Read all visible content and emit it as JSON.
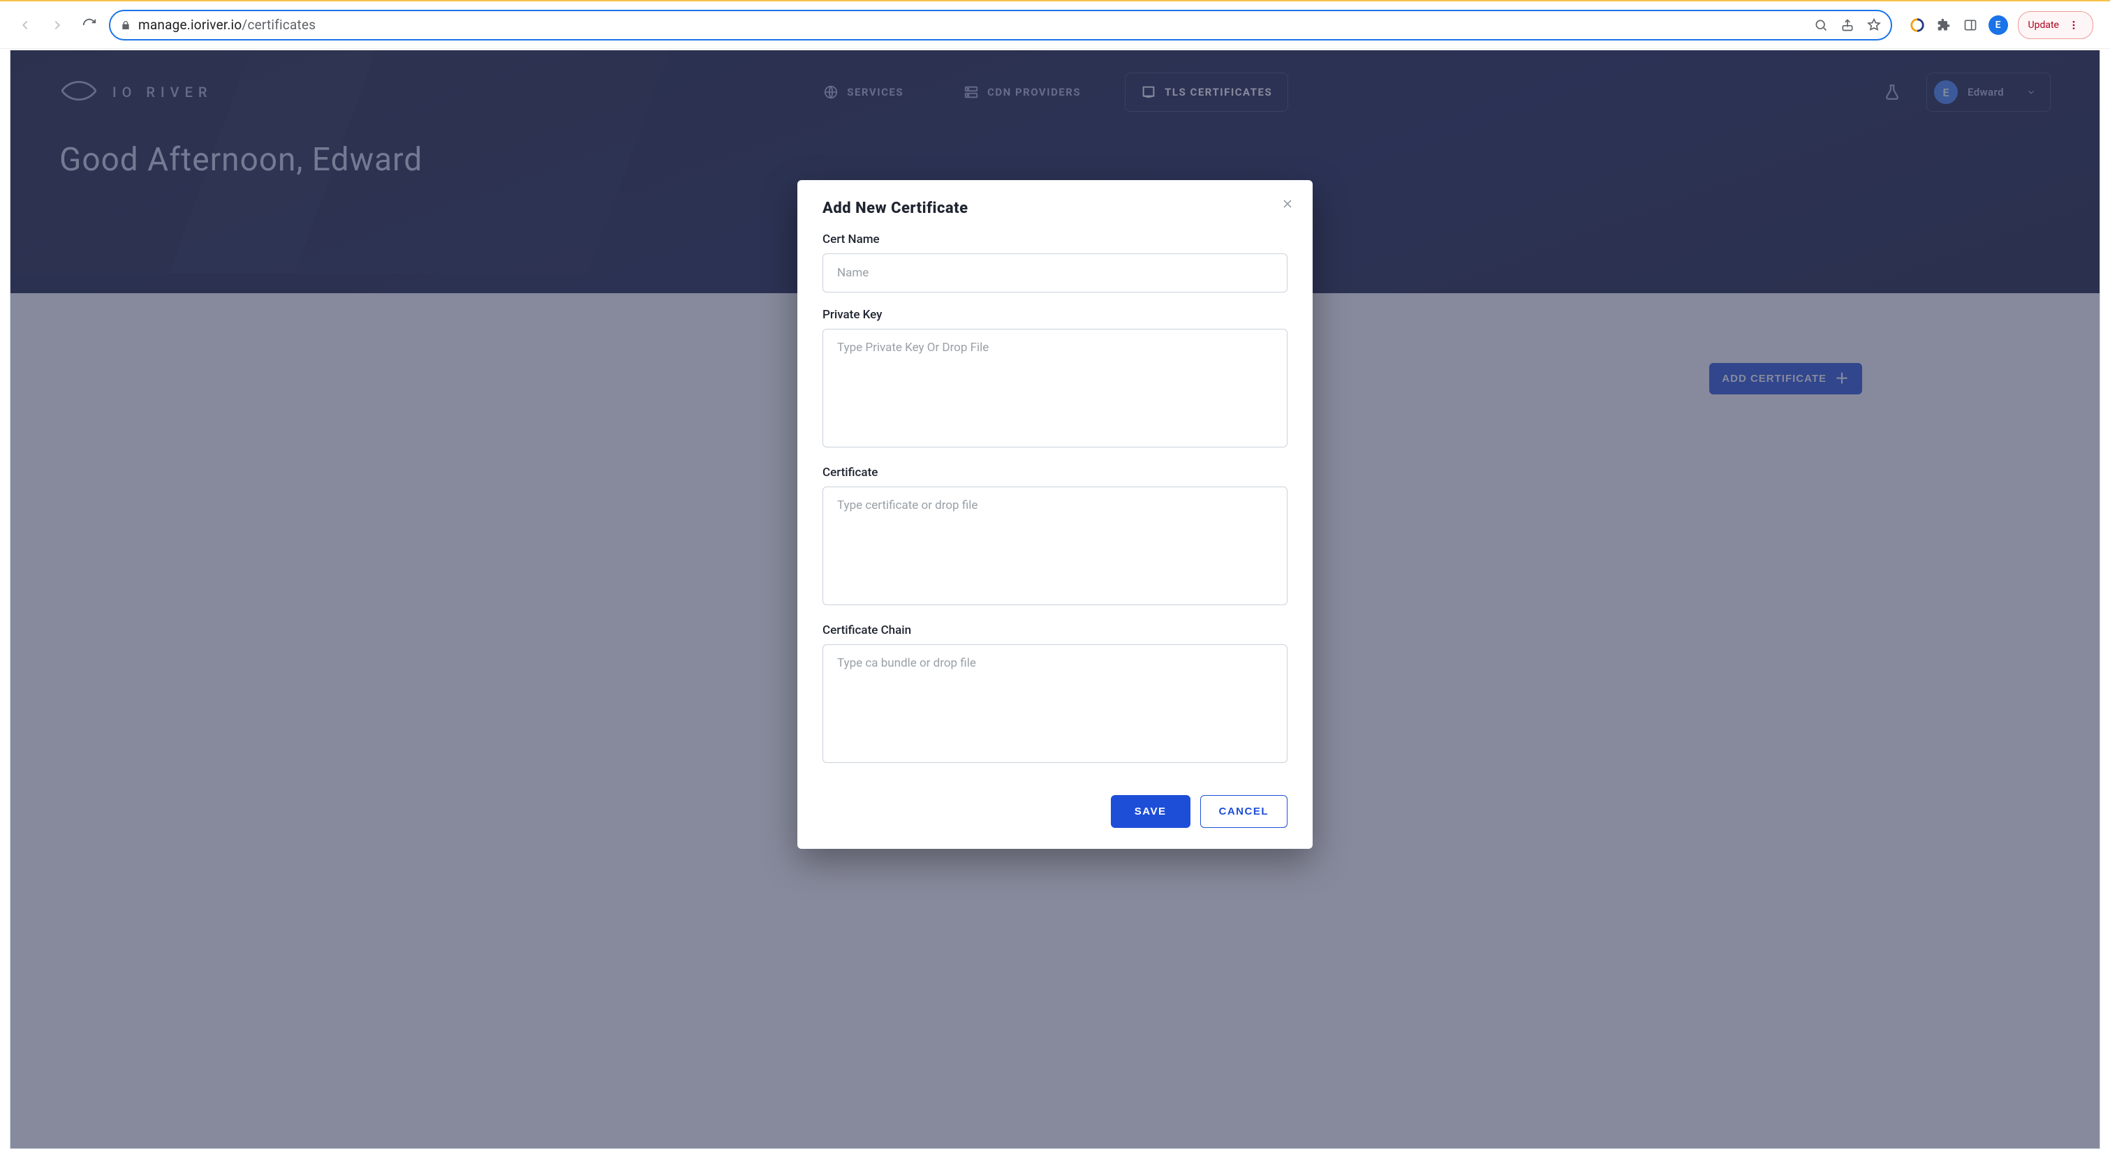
{
  "browser": {
    "url_host": "manage.ioriver.io",
    "url_path": "/certificates",
    "update_label": "Update",
    "profile_initial": "E"
  },
  "brand": {
    "name": "IO RIVER"
  },
  "nav": {
    "services": "SERVICES",
    "cdn": "CDN PROVIDERS",
    "tls": "TLS CERTIFICATES"
  },
  "user": {
    "initial": "E",
    "name": "Edward"
  },
  "greeting": "Good Afternoon, Edward",
  "buttons": {
    "add_certificate": "ADD CERTIFICATE"
  },
  "modal": {
    "title": "Add New Certificate",
    "cert_name_label": "Cert Name",
    "cert_name_placeholder": "Name",
    "private_key_label": "Private Key",
    "private_key_placeholder": "Type Private Key Or Drop File",
    "certificate_label": "Certificate",
    "certificate_placeholder": "Type certificate or drop file",
    "chain_label": "Certificate Chain",
    "chain_placeholder": "Type ca bundle or drop file",
    "save": "SAVE",
    "cancel": "CANCEL"
  }
}
